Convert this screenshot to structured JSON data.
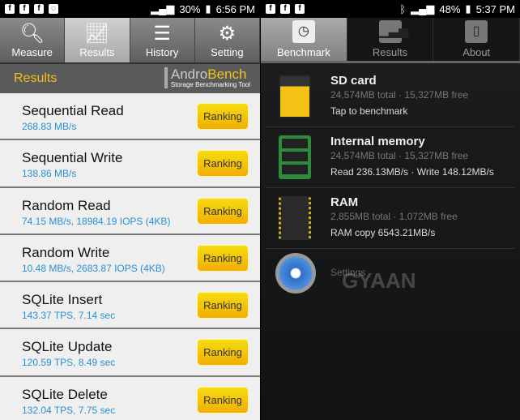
{
  "left": {
    "status": {
      "battery": "30%",
      "time": "6:56 PM"
    },
    "tabs": [
      {
        "label": "Measure",
        "icon": "search-icon"
      },
      {
        "label": "Results",
        "icon": "chart-icon",
        "active": true
      },
      {
        "label": "History",
        "icon": "list-icon"
      },
      {
        "label": "Setting",
        "icon": "gear-icon"
      }
    ],
    "header": {
      "title": "Results",
      "logo_a": "Andro",
      "logo_b": "Bench",
      "logo_sub": "Storage Benchmarking Tool"
    },
    "rows": [
      {
        "name": "Sequential Read",
        "value": "268.83 MB/s",
        "button": "Ranking"
      },
      {
        "name": "Sequential Write",
        "value": "138.86 MB/s",
        "button": "Ranking"
      },
      {
        "name": "Random Read",
        "value": "74.15 MB/s, 18984.19 IOPS (4KB)",
        "button": "Ranking"
      },
      {
        "name": "Random Write",
        "value": "10.48 MB/s, 2683.87 IOPS (4KB)",
        "button": "Ranking"
      },
      {
        "name": "SQLite Insert",
        "value": "143.37 TPS, 7.14 sec",
        "button": "Ranking"
      },
      {
        "name": "SQLite Update",
        "value": "120.59 TPS, 8.49 sec",
        "button": "Ranking"
      },
      {
        "name": "SQLite Delete",
        "value": "132.04 TPS, 7.75 sec",
        "button": "Ranking"
      }
    ]
  },
  "right": {
    "status": {
      "battery": "48%",
      "time": "5:37 PM"
    },
    "tabs": [
      {
        "label": "Benchmark",
        "icon": "speedometer-icon",
        "active": true
      },
      {
        "label": "Results",
        "icon": "bar-chart-icon"
      },
      {
        "label": "About",
        "icon": "phone-icon"
      }
    ],
    "items": [
      {
        "title": "SD card",
        "sub": "24,574MB total · 15,327MB free",
        "detail": "Tap to benchmark"
      },
      {
        "title": "Internal memory",
        "sub": "24,574MB total · 15,327MB free",
        "detail": "Read 236.13MB/s · Write 148.12MB/s"
      },
      {
        "title": "RAM",
        "sub": "2,855MB total · 1,072MB free",
        "detail": "RAM copy 6543.21MB/s"
      }
    ],
    "settings": "Settings",
    "watermark": "GYAAN"
  }
}
